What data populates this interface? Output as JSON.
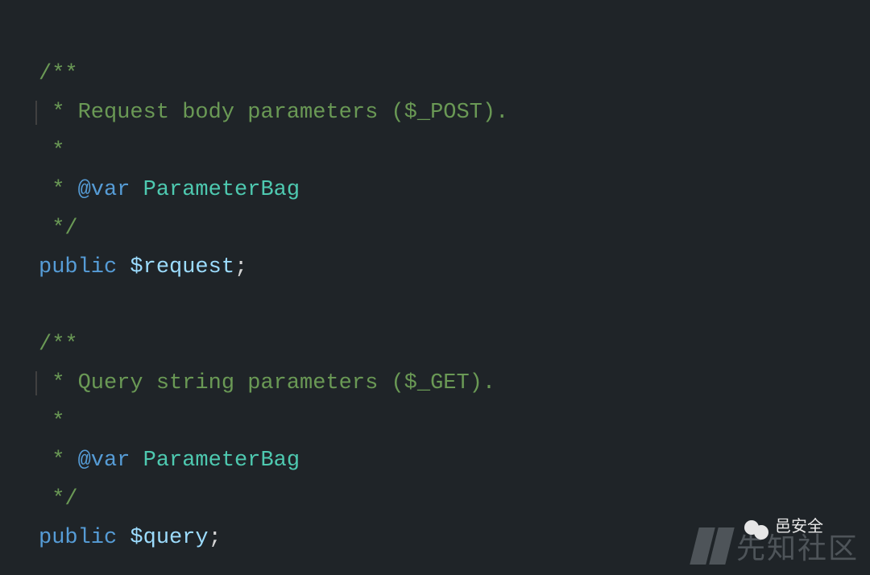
{
  "code": {
    "block1": {
      "open": "/**",
      "desc": " * Request body parameters ($_POST).",
      "blank": " *",
      "varline_prefix": " * ",
      "tag": "@var",
      "type": "ParameterBag",
      "close": " */",
      "keyword": "public",
      "variable": "$request",
      "semi": ";"
    },
    "block2": {
      "open": "/**",
      "desc": " * Query string parameters ($_GET).",
      "blank": " *",
      "varline_prefix": " * ",
      "tag": "@var",
      "type": "ParameterBag",
      "close": " */",
      "keyword": "public",
      "variable": "$query",
      "semi": ";"
    }
  },
  "watermark": {
    "label_small": "邑安全",
    "label_big": "先知社区"
  }
}
